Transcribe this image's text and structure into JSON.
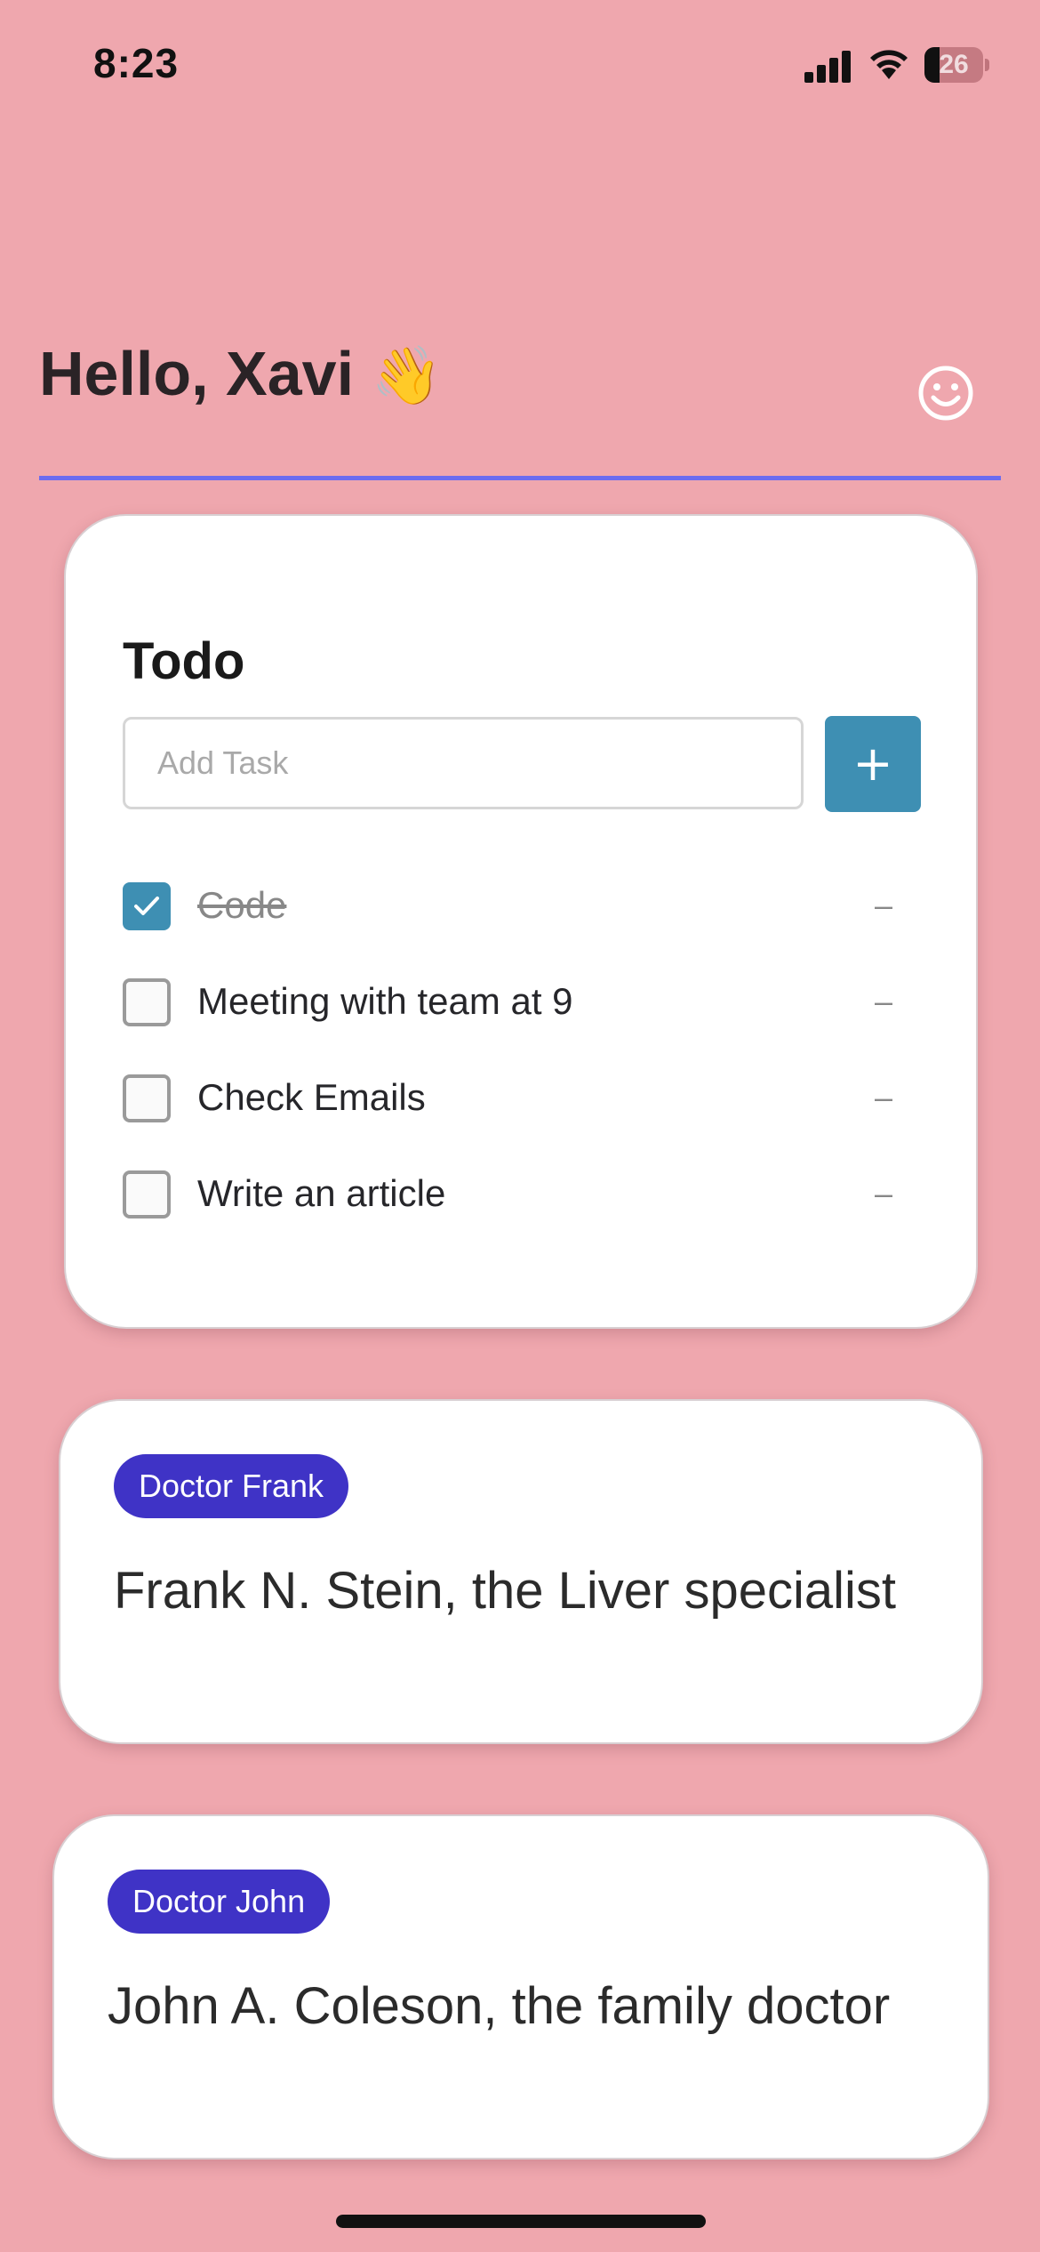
{
  "status_bar": {
    "time": "8:23",
    "battery_level": "26",
    "battery_fraction": 0.26,
    "icons": [
      "signal-icon",
      "wifi-icon",
      "battery-icon"
    ]
  },
  "header": {
    "greeting": "Hello, Xavi",
    "emoji": "👋",
    "profile_icon": "smiley-face-icon"
  },
  "todo": {
    "title": "Todo",
    "input_placeholder": "Add Task",
    "input_value": "",
    "add_button_label": "+",
    "remove_label": "–",
    "tasks": [
      {
        "label": "Code",
        "done": true
      },
      {
        "label": "Meeting with team at 9",
        "done": false
      },
      {
        "label": "Check Emails",
        "done": false
      },
      {
        "label": "Write an article",
        "done": false
      }
    ]
  },
  "doctors": [
    {
      "badge": "Doctor Frank",
      "description": "Frank N. Stein, the Liver specialist"
    },
    {
      "badge": "Doctor John",
      "description": "John A. Coleson, the family doctor"
    }
  ],
  "colors": {
    "background": "#EFA7AE",
    "accent": "#3E8FB3",
    "badge": "#3F33C6",
    "divider": "#6B6CF0"
  }
}
